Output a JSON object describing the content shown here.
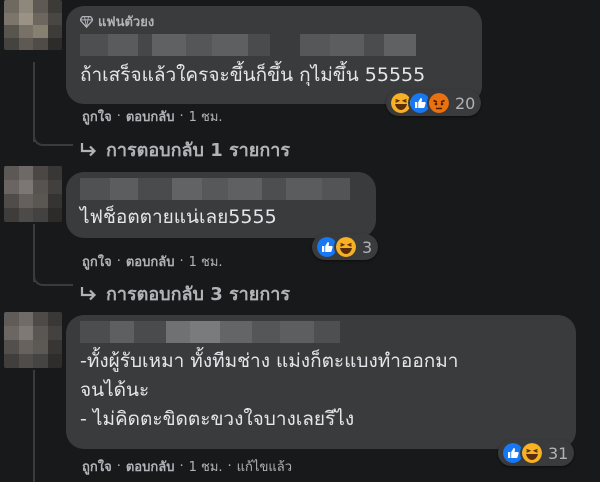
{
  "comments": [
    {
      "badge": "แฟนตัวยง",
      "text": "ถ้าเสร็จแล้วใครจะขึ้นก็ขึ้น กุไม่ขึ้น 55555",
      "like": "ถูกใจ",
      "reply": "ตอบกลับ",
      "time": "1 ชม.",
      "reaction_count": "20",
      "reactions": [
        "haha-icon",
        "like-icon",
        "angry-icon"
      ],
      "replies_link": "การตอบกลับ 1 รายการ"
    },
    {
      "text": "ไฟช็อตตายแน่เลย5555",
      "like": "ถูกใจ",
      "reply": "ตอบกลับ",
      "time": "1 ชม.",
      "reaction_count": "3",
      "reactions": [
        "like-icon",
        "haha-icon"
      ],
      "replies_link": "การตอบกลับ 3 รายการ"
    },
    {
      "text": "-ทั้งผู้รับเหมา ทั้งทีมช่าง แม่งก็ตะแบงทำออกมา\nจนได้นะ\n-  ไม่คิดตะขิดตะขวงใจบางเลยรึไง",
      "like": "ถูกใจ",
      "reply": "ตอบกลับ",
      "time": "1 ชม.",
      "edited": "แก้ไขแล้ว",
      "reaction_count": "31",
      "reactions": [
        "like-icon",
        "haha-icon"
      ]
    }
  ],
  "separator": "·",
  "colors": {
    "background": "#18191a",
    "bubble": "#3a3b3c",
    "text": "#e4e6eb",
    "secondary": "#b0b3b8",
    "like_blue": "#1877f2",
    "haha_yellow": "#f7b125",
    "angry_orange": "#e9710f"
  }
}
